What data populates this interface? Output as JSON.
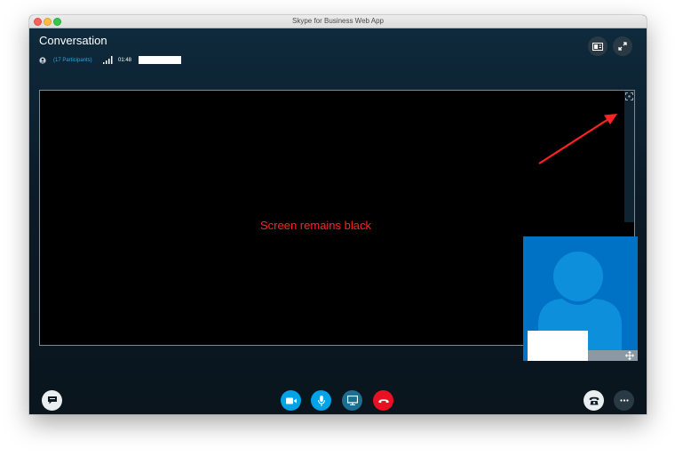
{
  "window": {
    "title": "Skype for Business Web App"
  },
  "header": {
    "title": "Conversation",
    "participants": "(17 Participants)",
    "duration": "01:48"
  },
  "stage": {
    "note": "Screen remains black"
  },
  "icons": {
    "layout": "layout-icon",
    "fullscreen": "fullscreen-icon",
    "focus": "focus-icon",
    "move": "move-icon",
    "im": "chat-icon",
    "video": "video-camera-icon",
    "mic": "microphone-icon",
    "present": "present-screen-icon",
    "hangup": "hang-up-icon",
    "dialpad": "phone-icon",
    "more": "more-options-icon"
  },
  "colors": {
    "accent": "#00a2e8",
    "present": "#1a6f93",
    "hangup": "#e81123",
    "annotation": "#ff2323",
    "avatar_bg": "#0072c6"
  }
}
